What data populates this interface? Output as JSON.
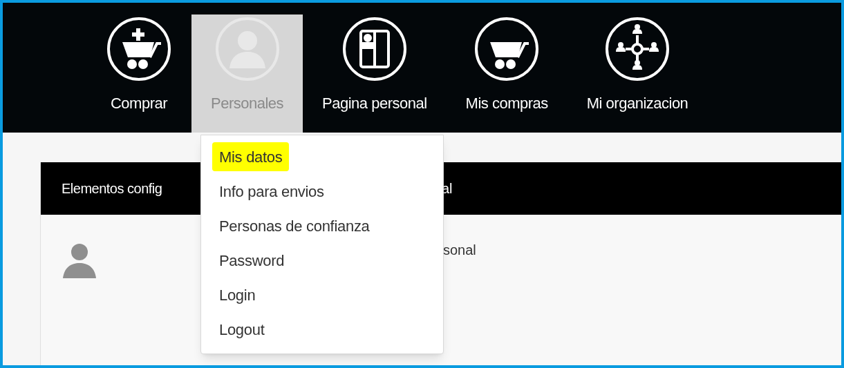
{
  "nav": {
    "items": [
      {
        "label": "Comprar",
        "kind": "cart-plus",
        "selected": false
      },
      {
        "label": "Personales",
        "kind": "user",
        "selected": true
      },
      {
        "label": "Pagina personal",
        "kind": "door",
        "selected": false
      },
      {
        "label": "Mis compras",
        "kind": "cart",
        "selected": false
      },
      {
        "label": "Mi organizacion",
        "kind": "network",
        "selected": false
      }
    ]
  },
  "dropdown": {
    "items": [
      {
        "label": "Mis datos",
        "highlighted": true
      },
      {
        "label": "Info para envios",
        "highlighted": false
      },
      {
        "label": "Personas de confianza",
        "highlighted": false
      },
      {
        "label": "Password",
        "highlighted": false
      },
      {
        "label": "Login",
        "highlighted": false
      },
      {
        "label": "Logout",
        "highlighted": false
      }
    ]
  },
  "panel": {
    "header_left": "Elementos config",
    "header_right": "al",
    "body_right": "sonal"
  }
}
